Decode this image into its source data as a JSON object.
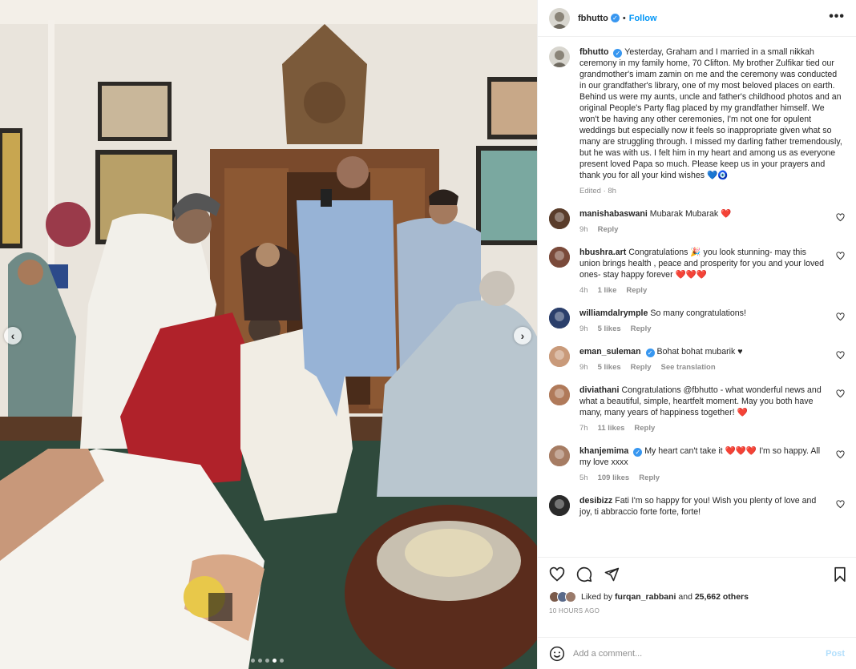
{
  "post": {
    "username": "fbhutto",
    "separator": "•",
    "follow_label": "Follow",
    "more_label": "•••"
  },
  "caption": {
    "username": "fbhutto",
    "text": "Yesterday, Graham and I married in a small nikkah ceremony in my family home, 70 Clifton. My brother Zulfikar tied our grandmother's imam zamin on me and the ceremony was conducted in our grandfather's library, one of my most beloved places on earth. Behind us were my aunts, uncle and father's childhood photos and an original People's Party flag placed by my grandfather himself. We won't be having any other ceremonies, I'm not one for opulent weddings but especially now it feels so inappropriate given what so many are struggling through. I missed my darling father tremendously, but he was with us. I felt him in my heart and among us as everyone present loved Papa so much. Please keep us in your prayers and thank you for all your kind wishes 💙🧿",
    "meta": "Edited · 8h"
  },
  "comments": [
    {
      "username": "manishabaswani",
      "verified": false,
      "text": "Mubarak Mubarak ❤️",
      "time": "9h",
      "likes": "",
      "reply": "Reply",
      "translate": "",
      "avatar_color": "#5a3d2b"
    },
    {
      "username": "hbushra.art",
      "verified": false,
      "text": "Congratulations 🎉 you look stunning- may this union brings health , peace and prosperity for you and your loved ones- stay happy forever ❤️❤️❤️",
      "time": "4h",
      "likes": "1 like",
      "reply": "Reply",
      "translate": "",
      "avatar_color": "#7a4a3a"
    },
    {
      "username": "williamdalrymple",
      "verified": false,
      "text": "So many congratulations!",
      "time": "9h",
      "likes": "5 likes",
      "reply": "Reply",
      "translate": "",
      "avatar_color": "#2b3f6b"
    },
    {
      "username": "eman_suleman",
      "verified": true,
      "text": "Bohat bohat mubarik ♥",
      "time": "9h",
      "likes": "5 likes",
      "reply": "Reply",
      "translate": "See translation",
      "avatar_color": "#c99a7a"
    },
    {
      "username": "diviathani",
      "verified": false,
      "text": "Congratulations @fbhutto - what wonderful news and what a beautiful, simple, heartfelt moment. May you both have many, many years of happiness together! ❤️",
      "time": "7h",
      "likes": "11 likes",
      "reply": "Reply",
      "translate": "",
      "avatar_color": "#b07a5a"
    },
    {
      "username": "khanjemima",
      "verified": true,
      "text": "My heart can't take it ❤️❤️❤️ I'm so happy. All my love xxxx",
      "time": "5h",
      "likes": "109 likes",
      "reply": "Reply",
      "translate": "",
      "avatar_color": "#a67c63"
    },
    {
      "username": "desibizz",
      "verified": false,
      "text": "Fati I'm so happy for you! Wish you plenty of love and joy, ti abbraccio forte forte, forte!",
      "time": "",
      "likes": "",
      "reply": "",
      "translate": "",
      "avatar_color": "#2a2a2a"
    }
  ],
  "engagement": {
    "liked_prefix": "Liked by",
    "liked_user": "furqan_rabbani",
    "liked_and": "and",
    "liked_others": "25,662 others",
    "time_ago": "10 HOURS AGO"
  },
  "add_comment": {
    "placeholder": "Add a comment...",
    "post_label": "Post"
  },
  "carousel": {
    "prev_icon": "‹",
    "next_icon": "›",
    "slide_count": 5,
    "active_slide": 4
  },
  "colors": {
    "accent": "#0095f6",
    "verified": "#3897f0",
    "heart": "#ed4956"
  }
}
